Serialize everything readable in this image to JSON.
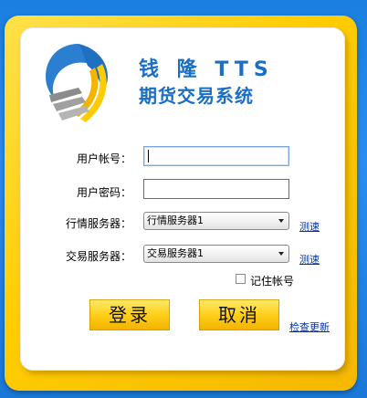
{
  "header": {
    "title_line1": "钱 隆 TTS",
    "title_line2": "期货交易系统"
  },
  "form": {
    "account_label": "用户帐号：",
    "account_value": "",
    "password_label": "用户密码：",
    "password_value": "",
    "quote_server_label": "行情服务器：",
    "quote_server_value": "行情服务器1",
    "trade_server_label": "交易服务器：",
    "trade_server_value": "交易服务器1",
    "speed_test_label": "测速",
    "remember_label": "记住帐号",
    "remember_checked": false
  },
  "buttons": {
    "login_label": "登录",
    "cancel_label": "取消",
    "check_update_label": "检查更新"
  },
  "colors": {
    "frame": "#ffcc00",
    "title": "#1a6fc4",
    "background": "#2a8ef0"
  }
}
